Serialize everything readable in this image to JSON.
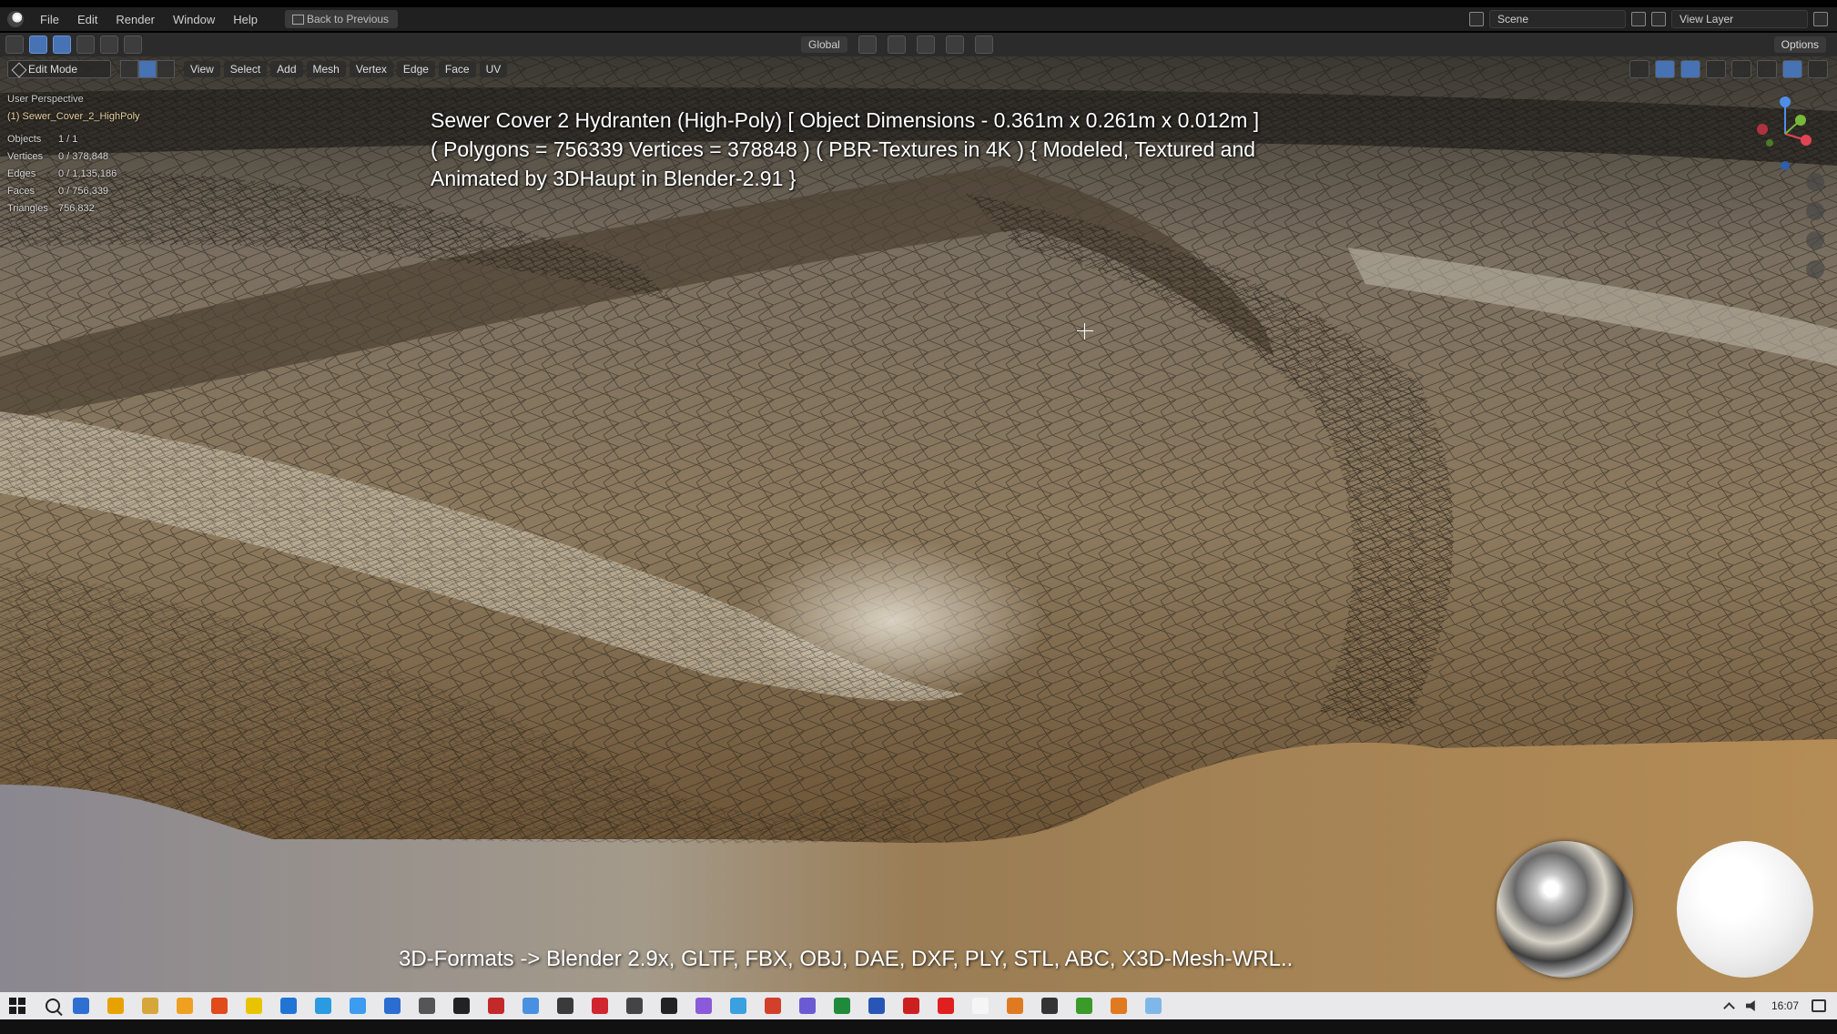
{
  "menubar": {
    "items": [
      "File",
      "Edit",
      "Render",
      "Window",
      "Help"
    ],
    "back_button": "Back to Previous",
    "scene_field": "Scene",
    "view_layer_field": "View Layer"
  },
  "toolbar": {
    "orientation": "Global",
    "options": "Options"
  },
  "viewport_header": {
    "mode": "Edit Mode",
    "menus": [
      "View",
      "Select",
      "Add",
      "Mesh",
      "Vertex",
      "Edge",
      "Face",
      "UV"
    ]
  },
  "overlay": {
    "perspective": "User Perspective",
    "object_name": "(1) Sewer_Cover_2_HighPoly",
    "stats": [
      {
        "label": "Objects",
        "value": "1 / 1"
      },
      {
        "label": "Vertices",
        "value": "0 / 378,848"
      },
      {
        "label": "Edges",
        "value": "0 / 1,135,186"
      },
      {
        "label": "Faces",
        "value": "0 / 756,339"
      },
      {
        "label": "Triangles",
        "value": "756,832"
      }
    ]
  },
  "caption": {
    "line1": "Sewer Cover 2 Hydranten (High-Poly) [ Object Dimensions -  0.361m x 0.261m x 0.012m ]",
    "line2": "( Polygons = 756339 Vertices = 378848 ) ( PBR-Textures in 4K ) { Modeled, Textured and",
    "line3": "Animated by 3DHaupt in Blender-2.91 }"
  },
  "formats_text": "3D-Formats -> Blender 2.9x, GLTF, FBX, OBJ, DAE, DXF, PLY, STL, ABC, X3D-Mesh-WRL..",
  "taskbar": {
    "time": "16:07",
    "app_colors": [
      "#2f6fd1",
      "#e8a200",
      "#d6a63a",
      "#f0a020",
      "#e14a1a",
      "#e8c400",
      "#1f74d6",
      "#2a9be0",
      "#3b9cf0",
      "#2b6dd0",
      "#555555",
      "#222222",
      "#c22a2a",
      "#4a90e0",
      "#3a3a3a",
      "#d0262f",
      "#444444",
      "#222222",
      "#8a5ad8",
      "#3aa0e0",
      "#d2402c",
      "#6b5bd2",
      "#1f8a3a",
      "#2856b6",
      "#cc2020",
      "#e02020",
      "#f5f5f5",
      "#e07a20",
      "#333333",
      "#3a9a2a",
      "#e07a20",
      "#7fb8e8"
    ]
  },
  "colors": {
    "accent": "#4772b3",
    "floor_warm": "#8a7456",
    "floor_light": "#b8aa92"
  }
}
